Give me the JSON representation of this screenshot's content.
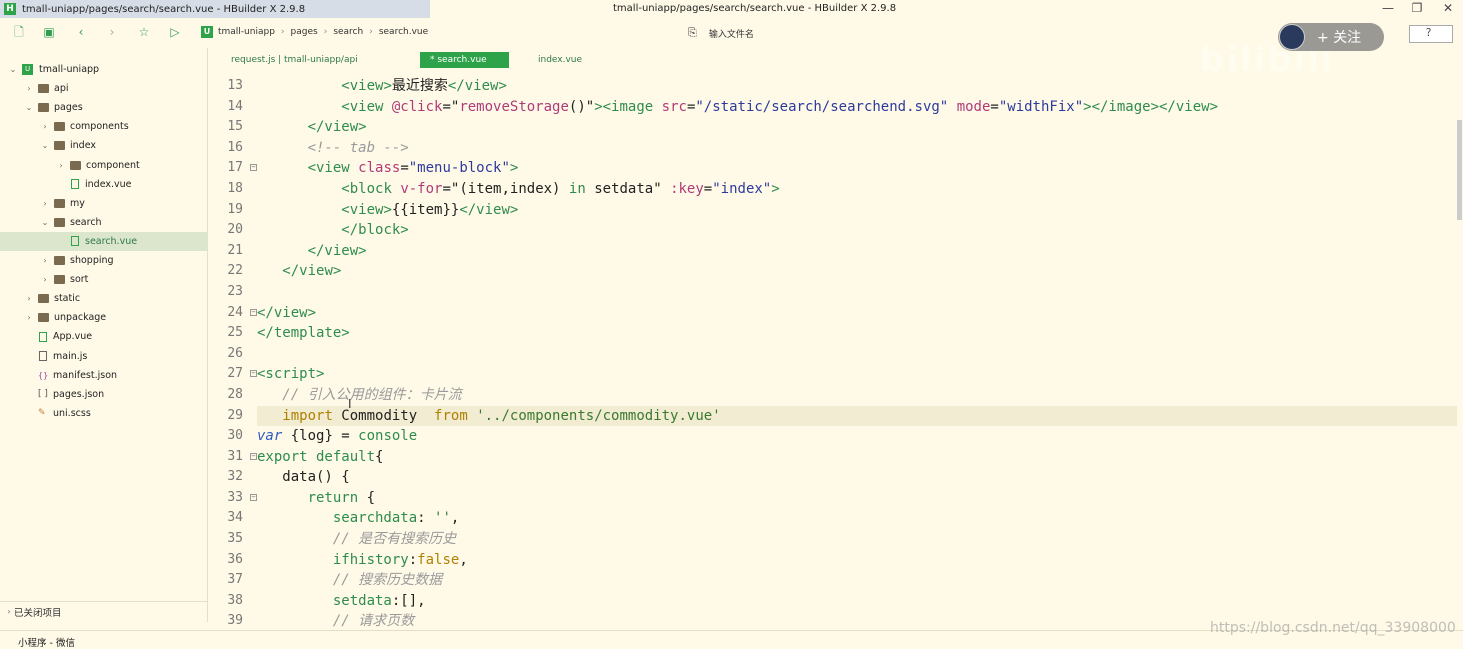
{
  "window": {
    "tab_title": "tmall-uniapp/pages/search/search.vue - HBuilder X 2.9.8",
    "title": "tmall-uniapp/pages/search/search.vue - HBuilder X 2.9.8",
    "minimize": "—",
    "restore": "❐",
    "close": "✕"
  },
  "toolbar": {
    "breadcrumb": [
      "tmall-uniapp",
      "pages",
      "search",
      "search.vue"
    ],
    "search_placeholder": "输入文件名",
    "follow_label": "+ 关注",
    "help_label": "？"
  },
  "sidebar": {
    "items": [
      {
        "label": "tmall-uniapp",
        "kind": "root",
        "depth": 0,
        "expanded": true
      },
      {
        "label": "api",
        "kind": "folder",
        "depth": 1,
        "expanded": false
      },
      {
        "label": "pages",
        "kind": "folder",
        "depth": 1,
        "expanded": true
      },
      {
        "label": "components",
        "kind": "folder",
        "depth": 2,
        "expanded": false
      },
      {
        "label": "index",
        "kind": "folder",
        "depth": 2,
        "expanded": true
      },
      {
        "label": "component",
        "kind": "folder",
        "depth": 3,
        "expanded": false
      },
      {
        "label": "index.vue",
        "kind": "vue",
        "depth": 3
      },
      {
        "label": "my",
        "kind": "folder",
        "depth": 2,
        "expanded": false
      },
      {
        "label": "search",
        "kind": "folder",
        "depth": 2,
        "expanded": true
      },
      {
        "label": "search.vue",
        "kind": "vue",
        "depth": 3,
        "selected": true
      },
      {
        "label": "shopping",
        "kind": "folder",
        "depth": 2,
        "expanded": false
      },
      {
        "label": "sort",
        "kind": "folder",
        "depth": 2,
        "expanded": false
      },
      {
        "label": "static",
        "kind": "folder",
        "depth": 1,
        "expanded": false
      },
      {
        "label": "unpackage",
        "kind": "folder",
        "depth": 1,
        "expanded": false
      },
      {
        "label": "App.vue",
        "kind": "vue",
        "depth": 1
      },
      {
        "label": "main.js",
        "kind": "js",
        "depth": 1
      },
      {
        "label": "manifest.json",
        "kind": "json",
        "depth": 1
      },
      {
        "label": "pages.json",
        "kind": "pages",
        "depth": 1
      },
      {
        "label": "uni.scss",
        "kind": "scss",
        "depth": 1
      }
    ],
    "closed_projects": "已关闭项目"
  },
  "tabs": [
    {
      "label": "request.js | tmall-uniapp/api",
      "active": false
    },
    {
      "label": "* search.vue",
      "active": true
    },
    {
      "label": "index.vue",
      "active": false
    }
  ],
  "editor": {
    "line_numbers": [
      "13",
      "14",
      "15",
      "16",
      "17",
      "18",
      "19",
      "20",
      "21",
      "22",
      "23",
      "24",
      "25",
      "26",
      "27",
      "28",
      "29",
      "30",
      "31",
      "32",
      "33",
      "34",
      "35",
      "36",
      "37",
      "38",
      "39"
    ],
    "folds": [
      "17",
      "24",
      "27",
      "31",
      "33"
    ],
    "highlighted_line": "29"
  },
  "statusbar": {
    "left": "小程序 - 微信"
  },
  "watermark": "https://blog.csdn.net/qq_33908000",
  "overlay_brand": "bilibili",
  "colors": {
    "accent": "#2fa34a",
    "background": "#fffae8"
  }
}
